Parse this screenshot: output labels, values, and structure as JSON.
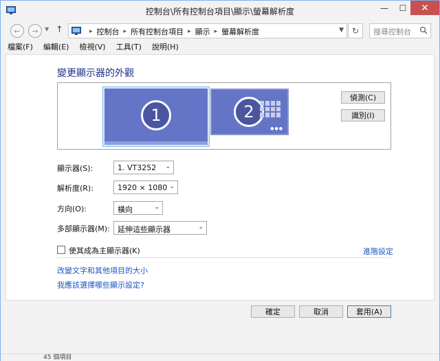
{
  "window": {
    "title": "控制台\\所有控制台項目\\顯示\\螢幕解析度",
    "minimize_glyph": "—",
    "maximize_glyph": "☐",
    "close_glyph": "✕"
  },
  "navigation": {
    "back_glyph": "←",
    "forward_glyph": "→",
    "up_glyph": "↑",
    "breadcrumbs": [
      "控制台",
      "所有控制台項目",
      "顯示",
      "螢幕解析度"
    ],
    "breadcrumb_separator": "▸",
    "refresh_glyph": "↻",
    "search_placeholder": "搜尋控制台"
  },
  "menubar": {
    "items": [
      "檔案(F)",
      "編輯(E)",
      "檢視(V)",
      "工具(T)",
      "說明(H)"
    ]
  },
  "main": {
    "heading": "變更顯示器的外觀",
    "monitor1_number": "1",
    "monitor2_number": "2",
    "monitor2_dots": "●●●",
    "detect_button": "偵測(C)",
    "identify_button": "識別(I)",
    "display_label": "顯示器(S):",
    "display_value": "1. VT3252",
    "resolution_label": "解析度(R):",
    "resolution_value": "1920 × 1080",
    "orientation_label": "方向(O):",
    "orientation_value": "橫向",
    "multiple_label": "多部顯示器(M):",
    "multiple_value": "延伸這些顯示器",
    "dropdown_arrow": "⌄",
    "main_display_checkbox_label": "使其成為主顯示器(K)",
    "advanced_link": "進階設定",
    "text_size_link": "改變文字和其他項目的大小",
    "which_settings_link": "我應該選擇哪些顯示設定?"
  },
  "actions": {
    "ok": "確定",
    "cancel": "取消",
    "apply": "套用(A)"
  },
  "statusbar": {
    "text": "45 個項目"
  },
  "colors": {
    "accent": "#1e3287",
    "link": "#1a55c4",
    "monitor": "#6475c8",
    "close_button": "#c75050"
  }
}
